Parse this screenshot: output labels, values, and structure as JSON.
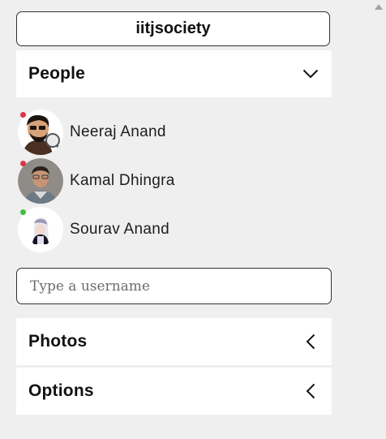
{
  "room": {
    "title": "iitjsociety"
  },
  "panels": {
    "people": {
      "label": "People",
      "icon": "chevron-down-icon",
      "expanded": true
    },
    "photos": {
      "label": "Photos",
      "icon": "chevron-left-icon",
      "expanded": false
    },
    "options": {
      "label": "Options",
      "icon": "chevron-left-icon",
      "expanded": false
    }
  },
  "people": [
    {
      "name": "Neeraj Anand",
      "status": "offline",
      "status_color": "#e0334a",
      "avatar": "cartoon-detective-avatar"
    },
    {
      "name": "Kamal Dhingra",
      "status": "offline",
      "status_color": "#e0334a",
      "avatar": "photo-avatar"
    },
    {
      "name": "Sourav Anand",
      "status": "online",
      "status_color": "#3fbf3f",
      "avatar": "anime-avatar"
    }
  ],
  "search": {
    "placeholder": "Type a username",
    "value": ""
  },
  "colors": {
    "background": "#efefef",
    "panel": "#ffffff",
    "border": "#2f2f3a"
  }
}
